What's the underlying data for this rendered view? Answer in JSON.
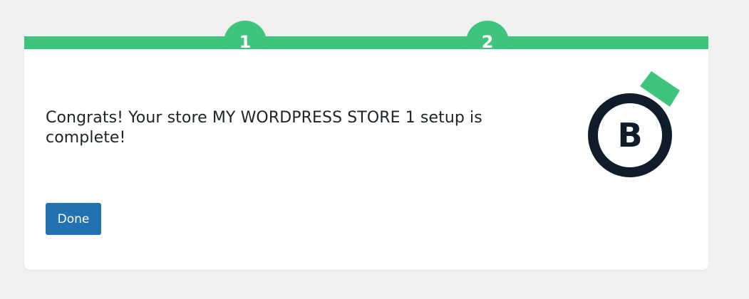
{
  "steps": [
    {
      "number": "1"
    },
    {
      "number": "2"
    }
  ],
  "message": "Congrats! Your store MY WORDPRESS STORE 1 setup is complete!",
  "done_label": "Done",
  "logo": {
    "letter": "B",
    "icon": "store-logo-icon"
  },
  "colors": {
    "accent": "#3ec47c",
    "button": "#2271b1",
    "logo_dark": "#0f1d2b",
    "background": "#f0f0f1"
  }
}
